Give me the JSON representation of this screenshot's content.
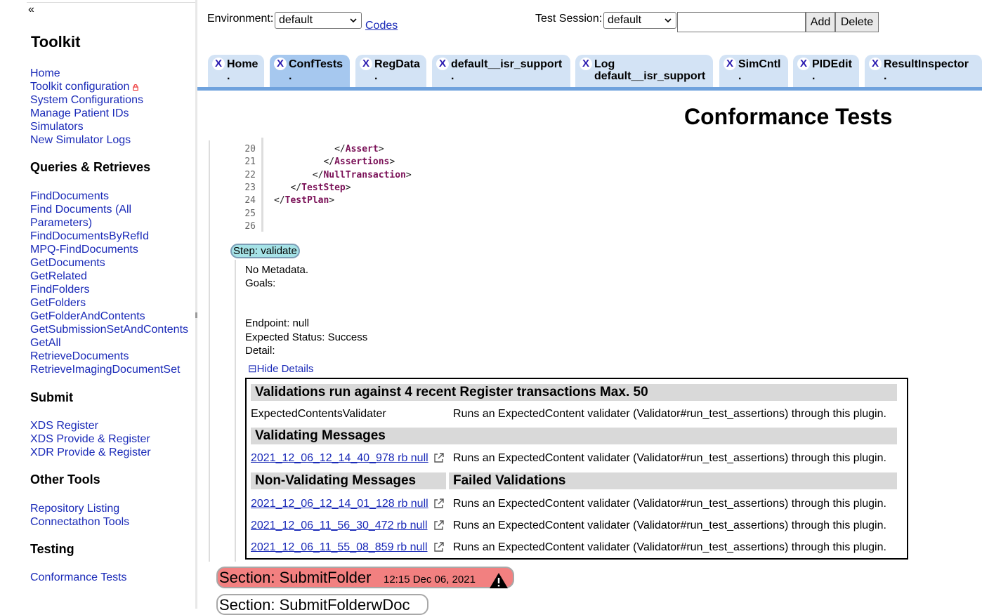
{
  "sidebar": {
    "collapse_glyph": "«",
    "title": "Toolkit",
    "groups": [
      {
        "links": [
          "Home",
          "Toolkit configuration",
          "System Configurations",
          "Manage Patient IDs",
          "Simulators",
          "New Simulator Logs"
        ]
      },
      {
        "heading": "Queries & Retrieves",
        "links": [
          "FindDocuments",
          "Find Documents (All Parameters)",
          "FindDocumentsByRefId",
          "MPQ-FindDocuments",
          "GetDocuments",
          "GetRelated",
          "FindFolders",
          "GetFolders",
          "GetFolderAndContents",
          "GetSubmissionSetAndContents",
          "GetAll",
          "RetrieveDocuments",
          "RetrieveImagingDocumentSet"
        ]
      },
      {
        "heading": "Submit",
        "links": [
          "XDS Register",
          "XDS Provide & Register",
          "XDR Provide & Register"
        ]
      },
      {
        "heading": "Other Tools",
        "links": [
          "Repository Listing",
          "Connectathon Tools"
        ]
      },
      {
        "heading": "Testing",
        "links": [
          "Conformance Tests"
        ]
      }
    ]
  },
  "toolbar": {
    "environment_label": "Environment:",
    "environment_value": "default",
    "codes_link": "Codes",
    "test_session_label": "Test Session:",
    "test_session_value": "default",
    "session_input_value": "",
    "add_label": "Add",
    "delete_label": "Delete"
  },
  "tabs": [
    {
      "close": "X",
      "label": "Home",
      "sub": "."
    },
    {
      "close": "X",
      "label": "ConfTests",
      "sub": ".",
      "active": true
    },
    {
      "close": "X",
      "label": "RegData",
      "sub": "."
    },
    {
      "close": "X",
      "label": "default__isr_support",
      "sub": "."
    },
    {
      "close": "X",
      "label": "Log",
      "sub": "default__isr_support"
    },
    {
      "close": "X",
      "label": "SimCntl",
      "sub": "."
    },
    {
      "close": "X",
      "label": "PIDEdit",
      "sub": "."
    },
    {
      "close": "X",
      "label": "ResultInspector",
      "sub": "."
    }
  ],
  "page_title": "Conformance Tests",
  "code": {
    "lines": [
      {
        "n": "20",
        "indent": "           ",
        "tag": "Assert"
      },
      {
        "n": "21",
        "indent": "         ",
        "tag": "Assertions"
      },
      {
        "n": "22",
        "indent": "       ",
        "tag": "NullTransaction"
      },
      {
        "n": "23",
        "indent": "   ",
        "tag": "TestStep"
      },
      {
        "n": "24",
        "indent": "",
        "tag": "TestPlan"
      },
      {
        "n": "25",
        "indent": "",
        "tag": ""
      },
      {
        "n": "26",
        "indent": "",
        "tag": ""
      }
    ]
  },
  "step": {
    "badge": "Step: validate",
    "no_metadata": "No Metadata.",
    "goals": "Goals:",
    "endpoint": "Endpoint: null",
    "expected_status": "Expected Status: Success",
    "detail": "Detail:",
    "hide_details": "⊟Hide Details"
  },
  "validations": {
    "heading": "Validations run against 4 recent Register transactions Max. 50",
    "validator_name": "ExpectedContentsValidater",
    "validator_desc": "Runs an ExpectedContent validater (Validator#run_test_assertions) through this plugin.",
    "validating_heading": "Validating Messages",
    "validating_rows": [
      {
        "link": "2021_12_06_12_14_40_978 rb null",
        "desc": "Runs an ExpectedContent validater (Validator#run_test_assertions) through this plugin."
      }
    ],
    "non_validating_heading": "Non-Validating Messages",
    "failed_heading": "Failed Validations",
    "non_validating_rows": [
      {
        "link": "2021_12_06_12_14_01_128 rb null",
        "desc": "Runs an ExpectedContent validater (Validator#run_test_assertions) through this plugin."
      },
      {
        "link": "2021_12_06_11_56_30_472 rb null",
        "desc": "Runs an ExpectedContent validater (Validator#run_test_assertions) through this plugin."
      },
      {
        "link": "2021_12_06_11_55_08_859 rb null",
        "desc": "Runs an ExpectedContent validater (Validator#run_test_assertions) through this plugin."
      }
    ]
  },
  "sections": [
    {
      "name": "Section: SubmitFolder",
      "time": "12:15 Dec 06, 2021",
      "status_color": "#f28080",
      "icon": "warning-icon"
    },
    {
      "name": "Section: SubmitFolderwDoc"
    }
  ],
  "colors": {
    "link": "#1a2ab8",
    "tab": "#d3e3f5",
    "tab_active": "#a6c8ef",
    "tab_rule": "#6fa2dd",
    "step_badge": "#a5e2e6",
    "section_fail": "#f28080"
  }
}
